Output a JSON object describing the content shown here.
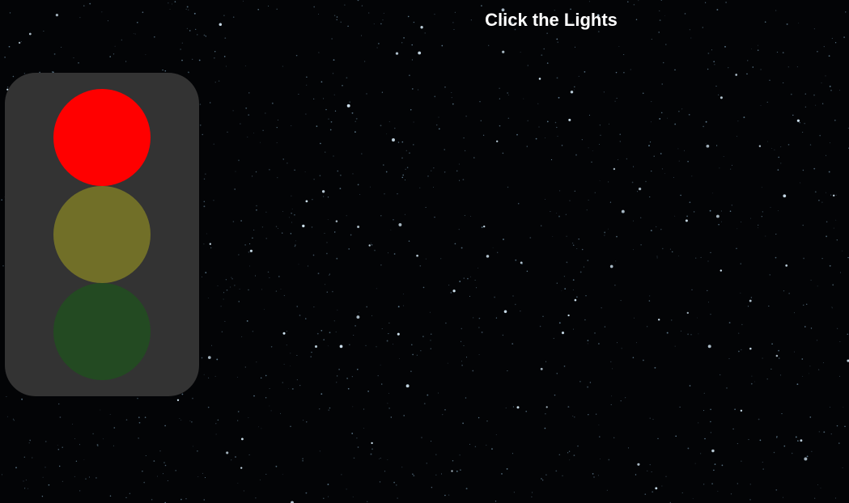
{
  "title": "Click the Lights",
  "colors": {
    "background": "#030406",
    "housing": "#333333",
    "star": "#cfe3f0",
    "star_dim": "#6f8ea3"
  },
  "lights": [
    {
      "id": "red",
      "on_color": "#ff0000",
      "off_color": "#5a1a1a",
      "state": "on"
    },
    {
      "id": "yellow",
      "on_color": "#ffff00",
      "off_color": "#716f28",
      "state": "off"
    },
    {
      "id": "green",
      "on_color": "#00ff00",
      "off_color": "#234a22",
      "state": "off"
    }
  ]
}
